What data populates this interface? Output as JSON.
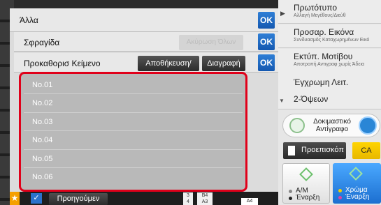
{
  "header": {
    "title": "Άλλα",
    "ok_label": "OK"
  },
  "stamp_row": {
    "label": "Σφραγίδα",
    "clear_all_label": "Ακύρωση Όλων",
    "ok_label": "OK"
  },
  "preset_row": {
    "label": "Προκαθορισ Κείμενο",
    "save_label": "Αποθήκευση/",
    "delete_label": "Διαγραφή",
    "ok_label": "OK"
  },
  "preset_list": [
    "No.01",
    "No.02",
    "No.03",
    "No.04",
    "No.05",
    "No.06"
  ],
  "right_menu": [
    {
      "title": "Πρωτότυπο",
      "subtitle": "Αλλαγή Μεγέθους/Διεύθ"
    },
    {
      "title": "Προσαρ. Εικόνα",
      "subtitle": "Συνδυασμός Καταχωρημένων Εικό"
    },
    {
      "title": "Εκτύπ. Μοτίβου",
      "subtitle": "Αποτροπή Αντιγραφ χωρίς Άδεια"
    },
    {
      "title": "Έγχρωμη Λειτ.",
      "subtitle": ""
    },
    {
      "title": "2-Όψεων",
      "subtitle": ""
    }
  ],
  "sample_copy": "Δοκιμαστικό Αντίγραφο",
  "preview": "Προεπισκόπ",
  "ca": "CA",
  "start_bw": {
    "line1": "Α/Μ",
    "line2": "Έναρξη"
  },
  "start_color": {
    "line1": "Χρώμα",
    "line2": "Έναρξη"
  },
  "bottom": {
    "previous": "Προηγούμεν",
    "paper_b4": "B4",
    "paper_a3": "A3",
    "paper_3": "3",
    "paper_4": "4",
    "paper_a4": "A4"
  },
  "colors": {
    "ok_blue": "#1f6fcb",
    "highlight_red": "#e0001a",
    "ca_yellow": "#f5c800",
    "start_blue": "#2a86d6"
  }
}
